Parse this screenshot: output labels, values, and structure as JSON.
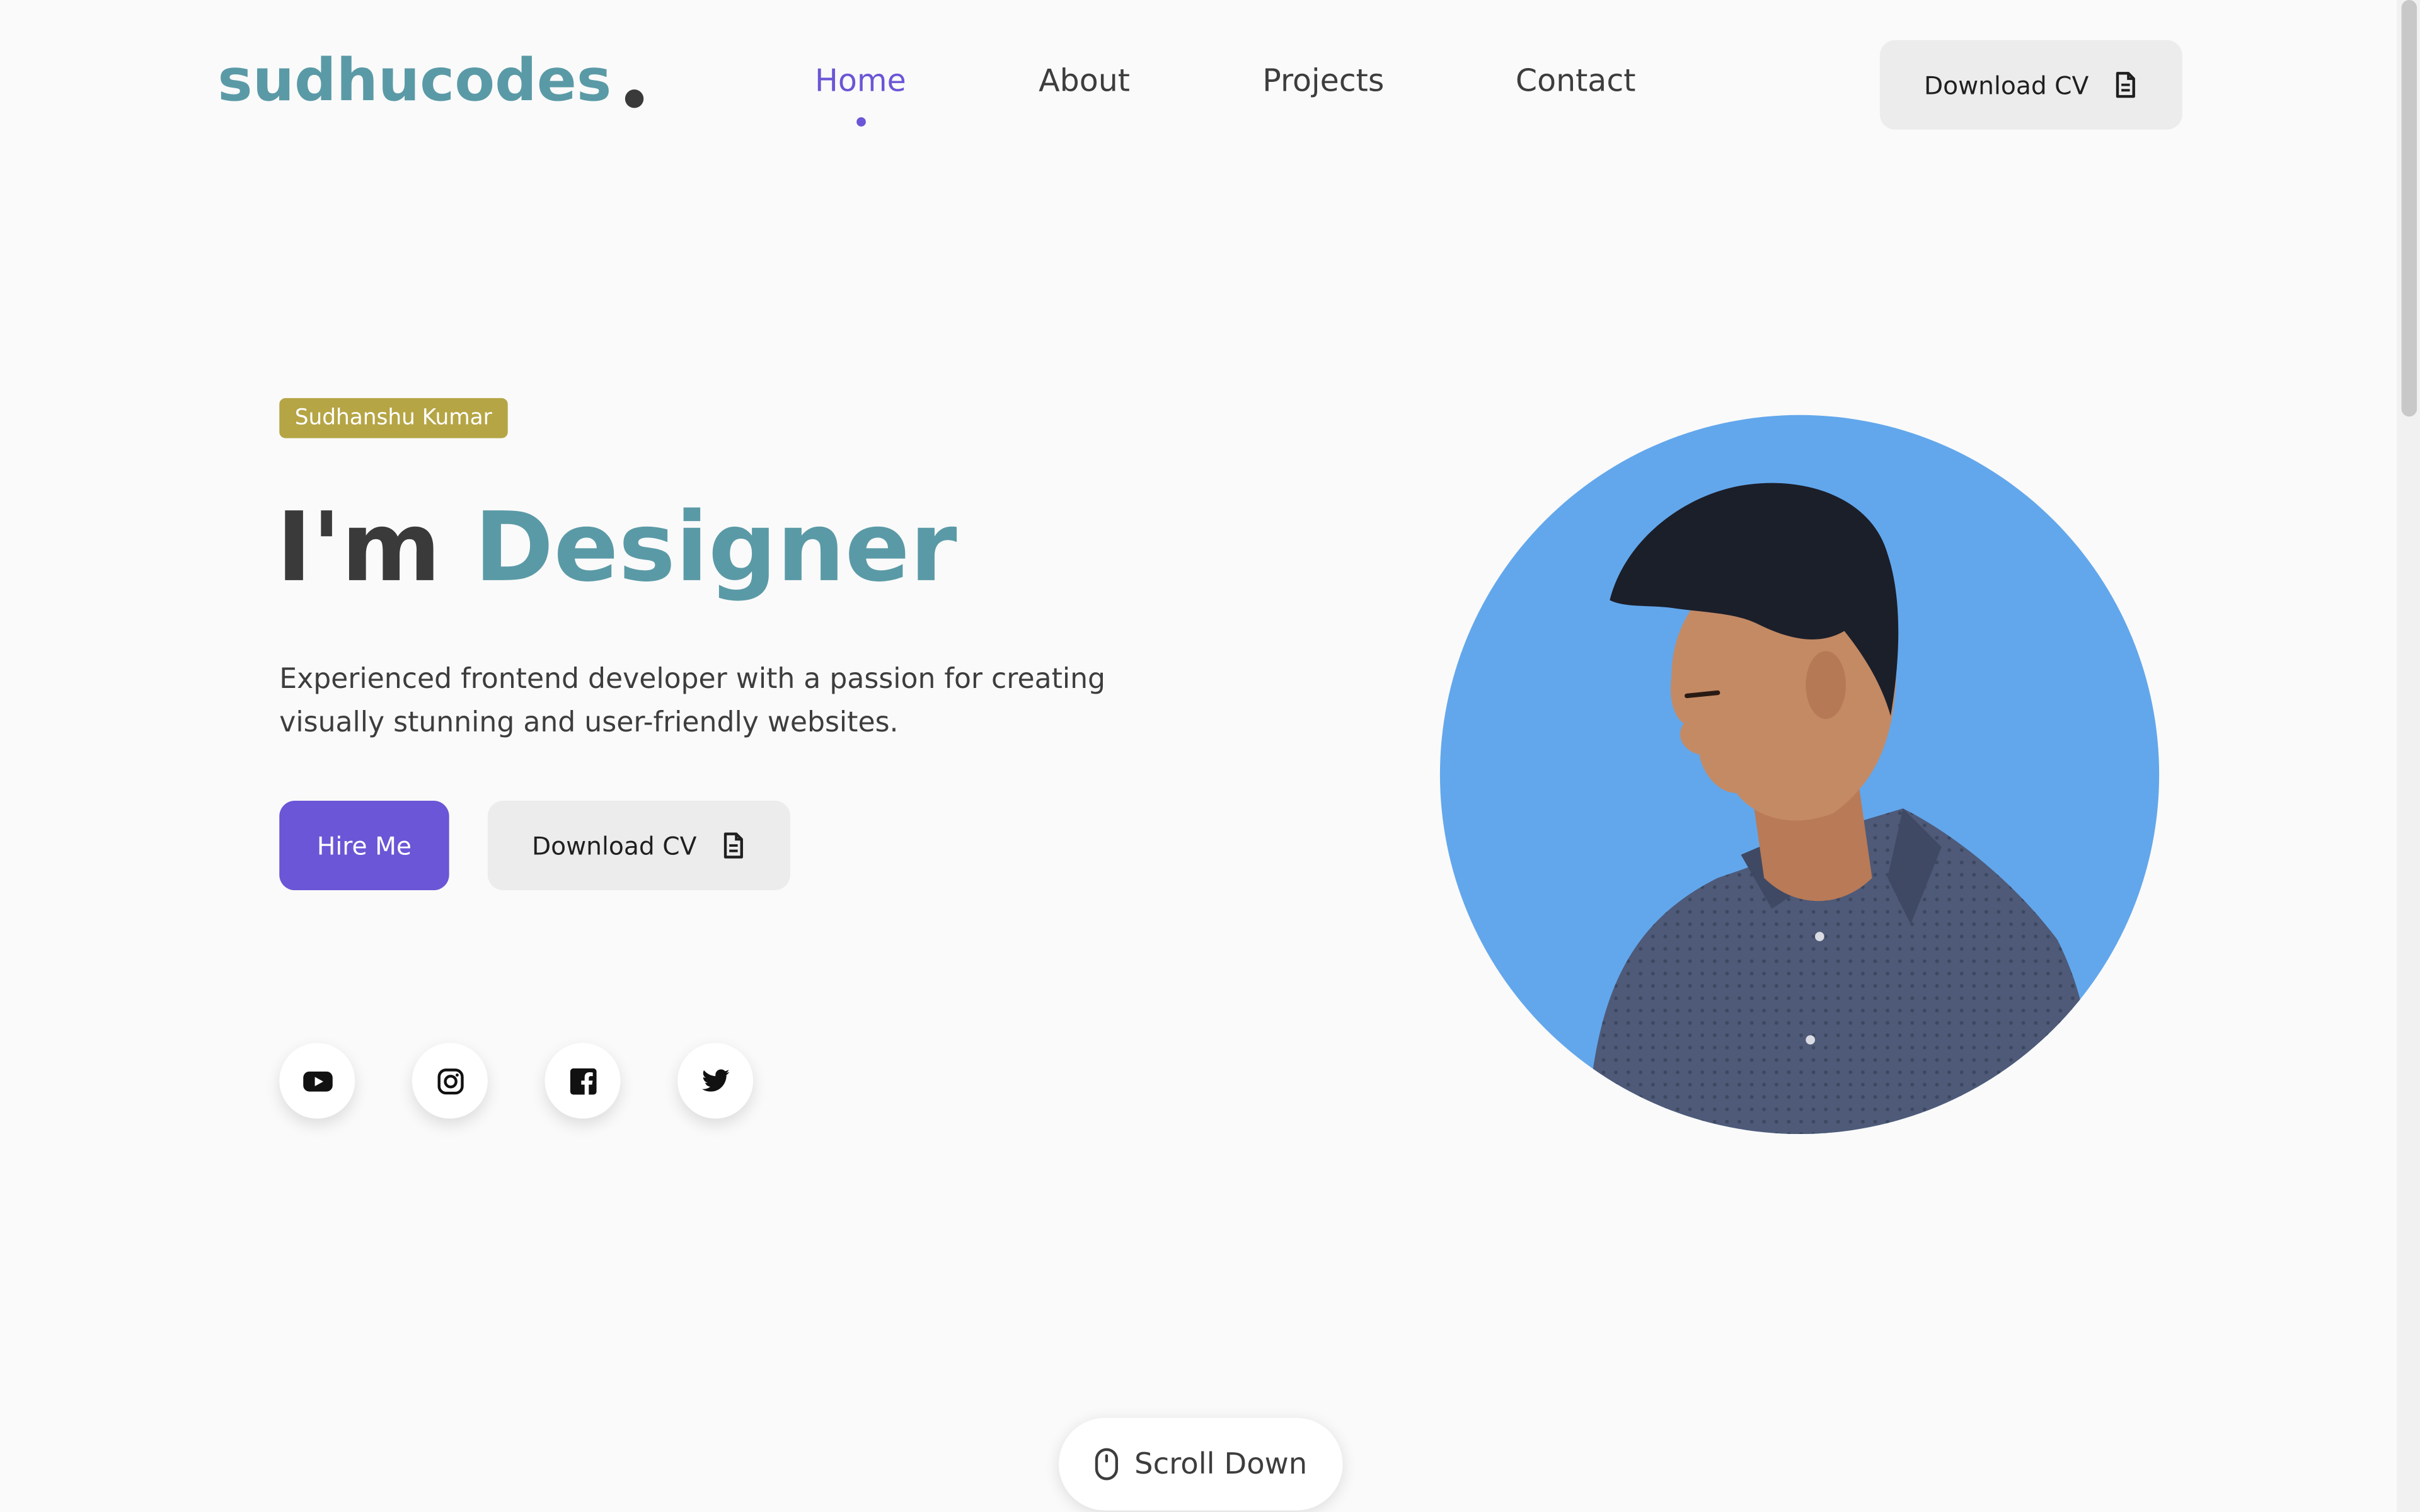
{
  "header": {
    "logo": "sudhucodes",
    "nav": [
      {
        "label": "Home",
        "active": true
      },
      {
        "label": "About",
        "active": false
      },
      {
        "label": "Projects",
        "active": false
      },
      {
        "label": "Contact",
        "active": false
      }
    ],
    "cv_button": "Download CV"
  },
  "hero": {
    "name_badge": "Sudhanshu Kumar",
    "headline_prefix": "I'm",
    "headline_accent": "Designer",
    "description": "Experienced frontend developer with a passion for creating visually stunning and user-friendly websites.",
    "hire_button": "Hire Me",
    "cv_button": "Download CV"
  },
  "socials": [
    "youtube-icon",
    "instagram-icon",
    "facebook-icon",
    "twitter-icon"
  ],
  "scroll_down": "Scroll Down",
  "colors": {
    "brand": "#5a9aa6",
    "accent": "#6a56d6",
    "badge": "#b5a545",
    "portrait_bg": "#62a7ec",
    "background": "#fafafa"
  }
}
